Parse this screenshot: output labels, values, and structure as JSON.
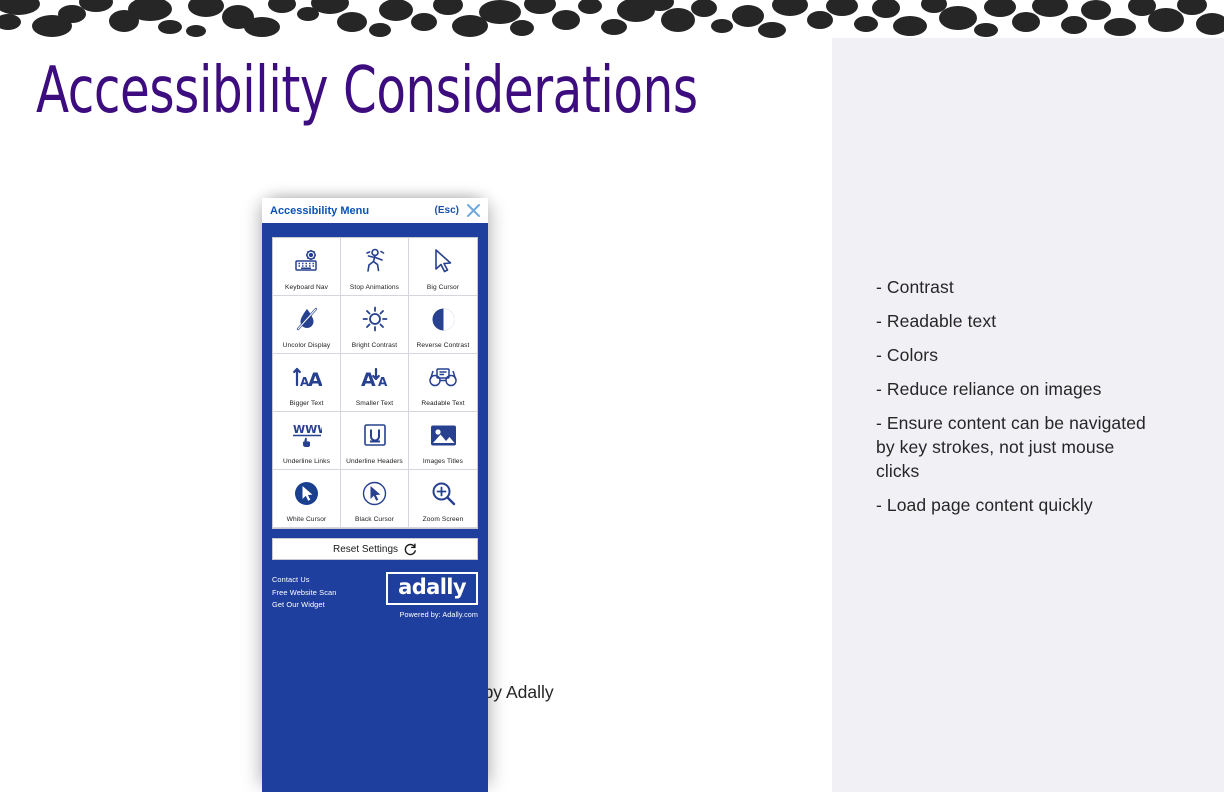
{
  "slide": {
    "title": "Accessibility Considerations",
    "title_color": "#3D0D80",
    "caption": "plugin by Adally",
    "panel_bg": "#F1F0F5",
    "top_border_pattern": "cow-print-spots"
  },
  "bullets": [
    "- Contrast",
    "- Readable text",
    "- Colors",
    "- Reduce reliance on images",
    "- Ensure content can be navigated by key strokes, not just mouse clicks",
    "- Load page content quickly"
  ],
  "widget": {
    "accent_color": "#1F3F9E",
    "titlebar": {
      "title": "Accessibility Menu",
      "esc_label": "(Esc)",
      "close_icon": "close-x-icon"
    },
    "tiles": [
      {
        "label": "Keyboard Nav",
        "icon": "keyboard-gear-icon"
      },
      {
        "label": "Stop Animations",
        "icon": "running-person-icon"
      },
      {
        "label": "Big Cursor",
        "icon": "large-arrow-cursor-icon"
      },
      {
        "label": "Uncolor Display",
        "icon": "droplet-slash-icon"
      },
      {
        "label": "Bright Contrast",
        "icon": "sun-icon"
      },
      {
        "label": "Reverse Contrast",
        "icon": "half-filled-circle-icon"
      },
      {
        "label": "Bigger Text",
        "icon": "text-increase-icon"
      },
      {
        "label": "Smaller Text",
        "icon": "text-decrease-icon"
      },
      {
        "label": "Readable Text",
        "icon": "reading-glasses-icon"
      },
      {
        "label": "Underline Links",
        "icon": "www-pointer-icon"
      },
      {
        "label": "Underline Headers",
        "icon": "underlined-u-icon"
      },
      {
        "label": "Images Titles",
        "icon": "picture-icon"
      },
      {
        "label": "White Cursor",
        "icon": "white-cursor-circle-icon"
      },
      {
        "label": "Black Cursor",
        "icon": "black-cursor-circle-icon"
      },
      {
        "label": "Zoom Screen",
        "icon": "magnifier-plus-icon"
      }
    ],
    "reset": {
      "label": "Reset Settings",
      "icon": "refresh-circular-arrow-icon"
    },
    "footer": {
      "links": [
        "Contact Us",
        "Free Website Scan",
        "Get Our Widget"
      ],
      "brand": "adally",
      "powered_by": "Powered by: Adally.com"
    }
  }
}
